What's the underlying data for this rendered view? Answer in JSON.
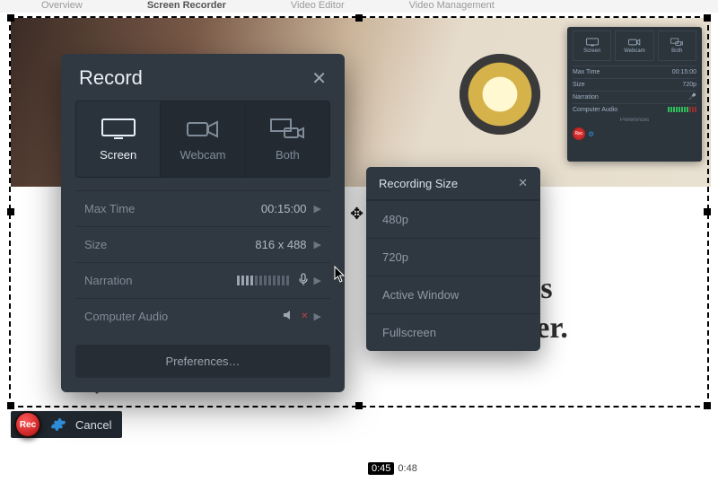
{
  "topnav": {
    "overview": "Overview",
    "recorder": "Screen Recorder",
    "editor": "Video Editor",
    "management": "Video Management"
  },
  "hero": {
    "headline_part1": "ur ideas",
    "headline_part2": "en easier."
  },
  "mini": {
    "screen": "Screen",
    "webcam": "Webcam",
    "both": "Both",
    "maxtime_label": "Max Time",
    "maxtime_value": "00:15:00",
    "size_label": "Size",
    "size_value": "720p",
    "narration_label": "Narration",
    "audio_label": "Computer Audio",
    "prefs": "Preferences",
    "rec": "Rec"
  },
  "record": {
    "title": "Record",
    "tabs": {
      "screen": "Screen",
      "webcam": "Webcam",
      "both": "Both"
    },
    "rows": {
      "maxtime_label": "Max Time",
      "maxtime_value": "00:15:00",
      "size_label": "Size",
      "size_value": "816 x 488",
      "narration_label": "Narration",
      "audio_label": "Computer Audio"
    },
    "prefs": "Preferences…"
  },
  "size_menu": {
    "title": "Recording Size",
    "options": {
      "o0": "480p",
      "o1": "720p",
      "o2": "Active Window",
      "o3": "Fullscreen"
    }
  },
  "controls": {
    "rec": "Rec",
    "cancel": "Cancel"
  },
  "playback": {
    "current": "0:45",
    "total": "0:48"
  }
}
